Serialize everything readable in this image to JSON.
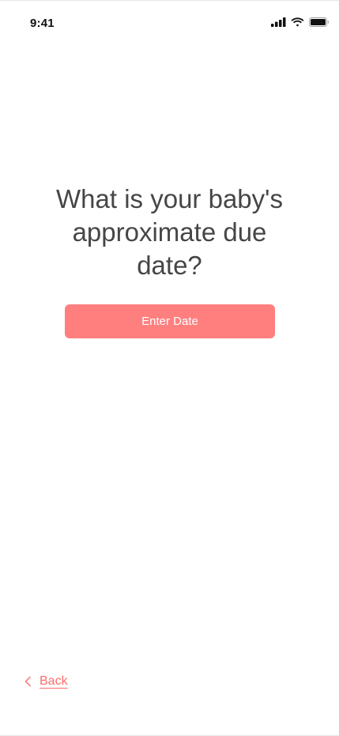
{
  "status_bar": {
    "time": "9:41",
    "icons": [
      "cellular-signal-icon",
      "wifi-icon",
      "battery-icon"
    ]
  },
  "question": {
    "line1": "What is your baby's",
    "line2": "approximate due",
    "line3": "date?"
  },
  "enter_date_button": {
    "label": "Enter Date"
  },
  "back": {
    "label": "Back",
    "icon": "chevron-left-icon"
  },
  "colors": {
    "accent": "#ff7f7f",
    "text": "#464646",
    "background": "#ffffff"
  }
}
